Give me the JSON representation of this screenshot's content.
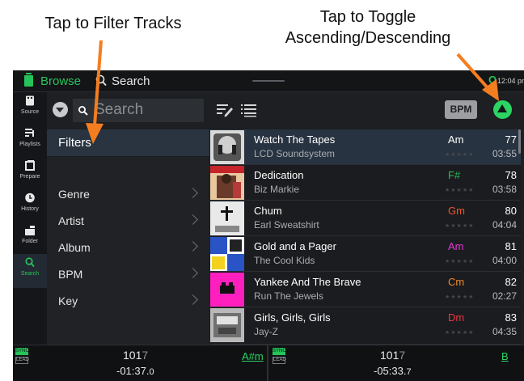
{
  "annotations": {
    "filter": "Tap to Filter Tracks",
    "sort_line1": "Tap to Toggle",
    "sort_line2": "Ascending/Descending",
    "arrow_color": "#f47d1f"
  },
  "topbar": {
    "browse_label": "Browse",
    "search_label": "Search",
    "q_indicator": "Q",
    "time": "12:04 pm",
    "accent_color": "#26c25a"
  },
  "nav": [
    {
      "label": "Source",
      "icon": "source-icon"
    },
    {
      "label": "Playlists",
      "icon": "playlists-icon"
    },
    {
      "label": "Prepare",
      "icon": "prepare-icon"
    },
    {
      "label": "History",
      "icon": "history-icon"
    },
    {
      "label": "Folder",
      "icon": "folder-icon"
    },
    {
      "label": "Search",
      "icon": "search-icon",
      "active": true
    }
  ],
  "search": {
    "placeholder": "Search",
    "sort_field": "BPM"
  },
  "filters": {
    "header": "Filters",
    "items": [
      "Genre",
      "Artist",
      "Album",
      "BPM",
      "Key"
    ]
  },
  "tracks": [
    {
      "title": "Watch The Tapes",
      "artist": "LCD Soundsystem",
      "key": "Am",
      "key_color": "#ffffff",
      "bpm": "77",
      "duration": "03:55",
      "stars": "★★★★★",
      "selected": true
    },
    {
      "title": "Dedication",
      "artist": "Biz Markie",
      "key": "F#",
      "key_color": "#2bbd55",
      "bpm": "78",
      "duration": "03:58",
      "stars": "★★★★★"
    },
    {
      "title": "Chum",
      "artist": "Earl Sweatshirt",
      "key": "Gm",
      "key_color": "#f0542b",
      "bpm": "80",
      "duration": "04:04",
      "stars": "★★★★★"
    },
    {
      "title": "Gold and a Pager",
      "artist": "The Cool Kids",
      "key": "Am",
      "key_color": "#e23ad3",
      "bpm": "81",
      "duration": "04:00",
      "stars": "★★★★★"
    },
    {
      "title": "Yankee And The Brave",
      "artist": "Run The Jewels",
      "key": "Cm",
      "key_color": "#f28a2b",
      "bpm": "82",
      "duration": "02:27",
      "stars": "★★★★★"
    },
    {
      "title": "Girls, Girls, Girls",
      "artist": "Jay-Z",
      "key": "Dm",
      "key_color": "#ee3443",
      "bpm": "83",
      "duration": "04:35",
      "stars": "★★★★★"
    }
  ],
  "decks": [
    {
      "sync": "SYNC",
      "lead": "LEAD",
      "bpm_int": "101",
      "bpm_dec": "7",
      "time_main": "-01:37.",
      "time_dec": "0",
      "key": "A#m"
    },
    {
      "sync": "SYNC",
      "lead": "LEAD",
      "bpm_int": "101",
      "bpm_dec": "7",
      "time_main": "-05:33.",
      "time_dec": "7",
      "key": "B"
    }
  ]
}
